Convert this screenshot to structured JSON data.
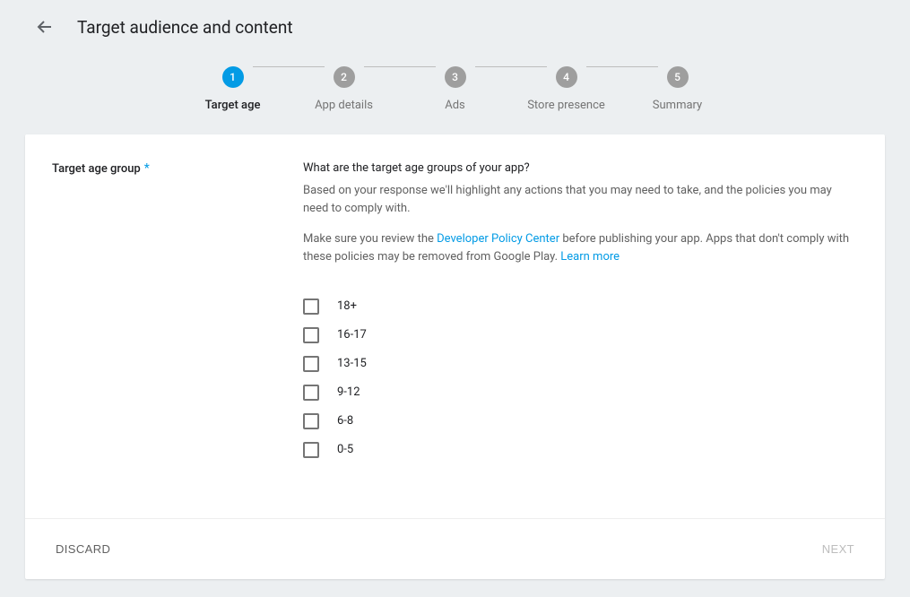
{
  "header": {
    "title": "Target audience and content"
  },
  "stepper": {
    "steps": [
      {
        "num": "1",
        "label": "Target age",
        "active": true
      },
      {
        "num": "2",
        "label": "App details",
        "active": false
      },
      {
        "num": "3",
        "label": "Ads",
        "active": false
      },
      {
        "num": "4",
        "label": "Store presence",
        "active": false
      },
      {
        "num": "5",
        "label": "Summary",
        "active": false
      }
    ]
  },
  "form": {
    "field_label": "Target age group",
    "required_marker": "*",
    "question": "What are the target age groups of your app?",
    "desc1": "Based on your response we'll highlight any actions that you may need to take, and the policies you may need to comply with.",
    "desc2_a": "Make sure you review the ",
    "desc2_link1": "Developer Policy Center",
    "desc2_b": " before publishing your app. Apps that don't comply with these policies may be removed from Google Play. ",
    "desc2_link2": "Learn more",
    "options": [
      {
        "label": "18+"
      },
      {
        "label": "16-17"
      },
      {
        "label": "13-15"
      },
      {
        "label": "9-12"
      },
      {
        "label": "6-8"
      },
      {
        "label": "0-5"
      }
    ]
  },
  "footer": {
    "discard": "Discard",
    "next": "Next"
  }
}
